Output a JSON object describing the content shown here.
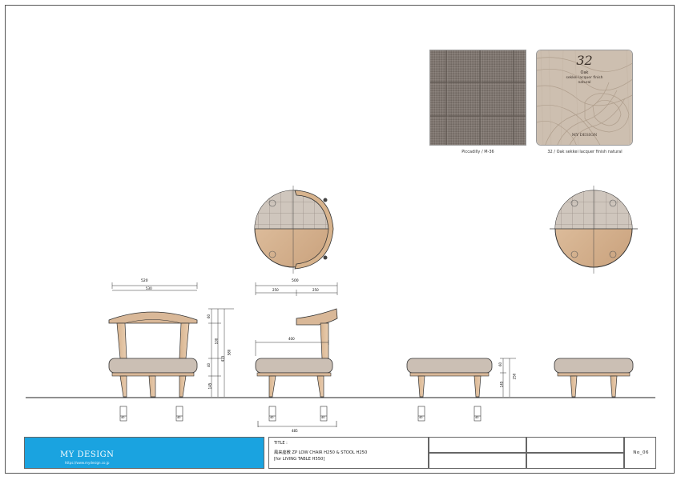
{
  "swatches": {
    "fabric_caption": "Piccadilly / M-36",
    "wood_caption": "32 / Oak sekkei lacquer finish natural",
    "wood_sample": {
      "number": "32",
      "line1": "Oak",
      "line2": "sekkei lacquer finish",
      "line3": "natural",
      "brand": "MY DESIGN"
    }
  },
  "dimensions": {
    "front_width": "520",
    "front_inner": "530",
    "side_depth": "500",
    "side_half_left": "250",
    "side_half_right": "250",
    "arm_depth": "400",
    "side_leg_span": "485",
    "h_top": "60",
    "h_back": "100",
    "h_total": "580",
    "h_seat": "415",
    "h_seat_cushion": "40",
    "h_leg": "145",
    "h_stool_total": "250",
    "h_stool_cushion": "60",
    "h_stool_leg": "145",
    "leg_width": "40"
  },
  "title_block": {
    "brand": "MY DESIGN",
    "url": "https://www.mydesign.co.jp",
    "title_label": "TITLE :",
    "title_line1": "風来座敷 ZP LOW CHAIR H250 & STOOL H250",
    "title_line2": "[for LIVING TABLE H550]",
    "sheet_no": "No_06"
  },
  "colors": {
    "wood": "#d9b898",
    "wood_dark": "#b8906a",
    "fabric": "#7d746e",
    "brand_blue": "#1aa3e0",
    "line": "#333333"
  }
}
